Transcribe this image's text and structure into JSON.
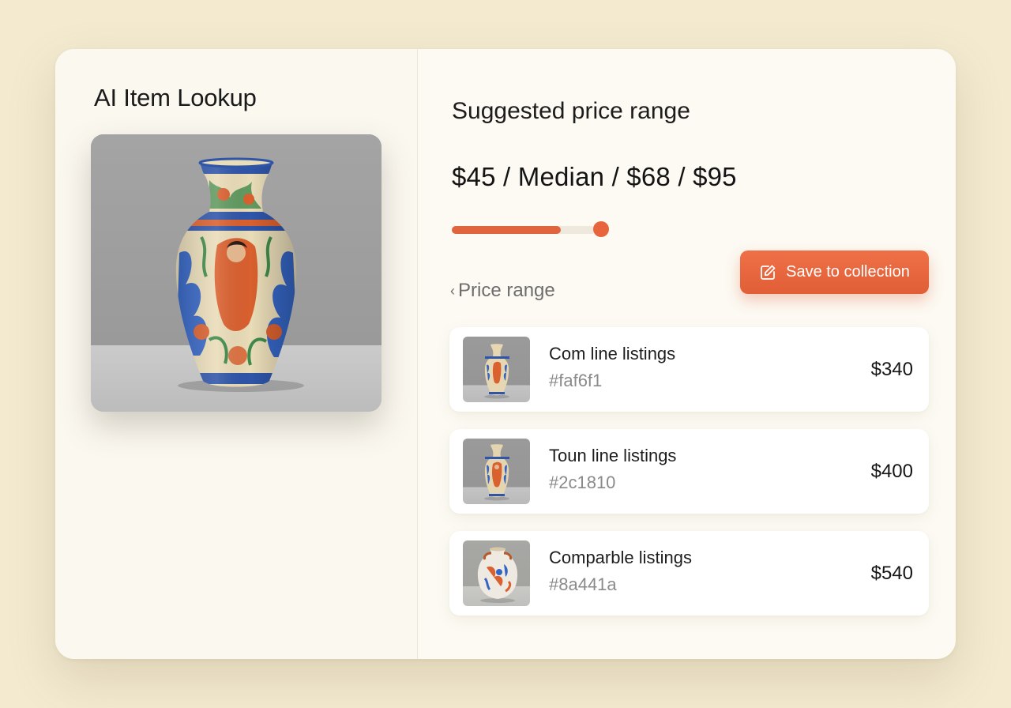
{
  "app": {
    "title": "AI Item Lookup"
  },
  "pricing": {
    "section_title": "Suggested price range",
    "summary": "$45 / Median / $68 / $95",
    "slider": {
      "fill_fraction": 0.76,
      "handle_fraction": 1.04
    }
  },
  "actions": {
    "save_label": "Save to collection",
    "save_icon": "edit-icon",
    "price_range_label": "Price range",
    "price_range_icon": "chevron-left-icon"
  },
  "listings": [
    {
      "title": "Com line listings",
      "code": "#faf6f1",
      "price": "$340"
    },
    {
      "title": "Toun line listings",
      "code": "#2c1810",
      "price": "$400"
    },
    {
      "title": "Comparble listings",
      "code": "#8a441a",
      "price": "$540"
    }
  ],
  "colors": {
    "accent": "#e8643c",
    "background": "#f3ead0",
    "card": "#fcfaf3"
  }
}
